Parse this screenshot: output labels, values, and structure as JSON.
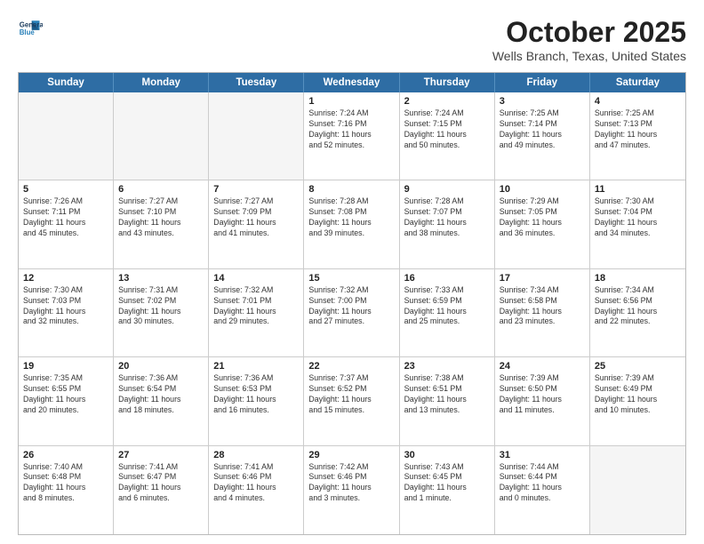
{
  "header": {
    "logo_line1": "General",
    "logo_line2": "Blue",
    "title": "October 2025",
    "subtitle": "Wells Branch, Texas, United States"
  },
  "weekdays": [
    "Sunday",
    "Monday",
    "Tuesday",
    "Wednesday",
    "Thursday",
    "Friday",
    "Saturday"
  ],
  "weeks": [
    [
      {
        "day": "",
        "info": ""
      },
      {
        "day": "",
        "info": ""
      },
      {
        "day": "",
        "info": ""
      },
      {
        "day": "1",
        "info": "Sunrise: 7:24 AM\nSunset: 7:16 PM\nDaylight: 11 hours\nand 52 minutes."
      },
      {
        "day": "2",
        "info": "Sunrise: 7:24 AM\nSunset: 7:15 PM\nDaylight: 11 hours\nand 50 minutes."
      },
      {
        "day": "3",
        "info": "Sunrise: 7:25 AM\nSunset: 7:14 PM\nDaylight: 11 hours\nand 49 minutes."
      },
      {
        "day": "4",
        "info": "Sunrise: 7:25 AM\nSunset: 7:13 PM\nDaylight: 11 hours\nand 47 minutes."
      }
    ],
    [
      {
        "day": "5",
        "info": "Sunrise: 7:26 AM\nSunset: 7:11 PM\nDaylight: 11 hours\nand 45 minutes."
      },
      {
        "day": "6",
        "info": "Sunrise: 7:27 AM\nSunset: 7:10 PM\nDaylight: 11 hours\nand 43 minutes."
      },
      {
        "day": "7",
        "info": "Sunrise: 7:27 AM\nSunset: 7:09 PM\nDaylight: 11 hours\nand 41 minutes."
      },
      {
        "day": "8",
        "info": "Sunrise: 7:28 AM\nSunset: 7:08 PM\nDaylight: 11 hours\nand 39 minutes."
      },
      {
        "day": "9",
        "info": "Sunrise: 7:28 AM\nSunset: 7:07 PM\nDaylight: 11 hours\nand 38 minutes."
      },
      {
        "day": "10",
        "info": "Sunrise: 7:29 AM\nSunset: 7:05 PM\nDaylight: 11 hours\nand 36 minutes."
      },
      {
        "day": "11",
        "info": "Sunrise: 7:30 AM\nSunset: 7:04 PM\nDaylight: 11 hours\nand 34 minutes."
      }
    ],
    [
      {
        "day": "12",
        "info": "Sunrise: 7:30 AM\nSunset: 7:03 PM\nDaylight: 11 hours\nand 32 minutes."
      },
      {
        "day": "13",
        "info": "Sunrise: 7:31 AM\nSunset: 7:02 PM\nDaylight: 11 hours\nand 30 minutes."
      },
      {
        "day": "14",
        "info": "Sunrise: 7:32 AM\nSunset: 7:01 PM\nDaylight: 11 hours\nand 29 minutes."
      },
      {
        "day": "15",
        "info": "Sunrise: 7:32 AM\nSunset: 7:00 PM\nDaylight: 11 hours\nand 27 minutes."
      },
      {
        "day": "16",
        "info": "Sunrise: 7:33 AM\nSunset: 6:59 PM\nDaylight: 11 hours\nand 25 minutes."
      },
      {
        "day": "17",
        "info": "Sunrise: 7:34 AM\nSunset: 6:58 PM\nDaylight: 11 hours\nand 23 minutes."
      },
      {
        "day": "18",
        "info": "Sunrise: 7:34 AM\nSunset: 6:56 PM\nDaylight: 11 hours\nand 22 minutes."
      }
    ],
    [
      {
        "day": "19",
        "info": "Sunrise: 7:35 AM\nSunset: 6:55 PM\nDaylight: 11 hours\nand 20 minutes."
      },
      {
        "day": "20",
        "info": "Sunrise: 7:36 AM\nSunset: 6:54 PM\nDaylight: 11 hours\nand 18 minutes."
      },
      {
        "day": "21",
        "info": "Sunrise: 7:36 AM\nSunset: 6:53 PM\nDaylight: 11 hours\nand 16 minutes."
      },
      {
        "day": "22",
        "info": "Sunrise: 7:37 AM\nSunset: 6:52 PM\nDaylight: 11 hours\nand 15 minutes."
      },
      {
        "day": "23",
        "info": "Sunrise: 7:38 AM\nSunset: 6:51 PM\nDaylight: 11 hours\nand 13 minutes."
      },
      {
        "day": "24",
        "info": "Sunrise: 7:39 AM\nSunset: 6:50 PM\nDaylight: 11 hours\nand 11 minutes."
      },
      {
        "day": "25",
        "info": "Sunrise: 7:39 AM\nSunset: 6:49 PM\nDaylight: 11 hours\nand 10 minutes."
      }
    ],
    [
      {
        "day": "26",
        "info": "Sunrise: 7:40 AM\nSunset: 6:48 PM\nDaylight: 11 hours\nand 8 minutes."
      },
      {
        "day": "27",
        "info": "Sunrise: 7:41 AM\nSunset: 6:47 PM\nDaylight: 11 hours\nand 6 minutes."
      },
      {
        "day": "28",
        "info": "Sunrise: 7:41 AM\nSunset: 6:46 PM\nDaylight: 11 hours\nand 4 minutes."
      },
      {
        "day": "29",
        "info": "Sunrise: 7:42 AM\nSunset: 6:46 PM\nDaylight: 11 hours\nand 3 minutes."
      },
      {
        "day": "30",
        "info": "Sunrise: 7:43 AM\nSunset: 6:45 PM\nDaylight: 11 hours\nand 1 minute."
      },
      {
        "day": "31",
        "info": "Sunrise: 7:44 AM\nSunset: 6:44 PM\nDaylight: 11 hours\nand 0 minutes."
      },
      {
        "day": "",
        "info": ""
      }
    ]
  ]
}
